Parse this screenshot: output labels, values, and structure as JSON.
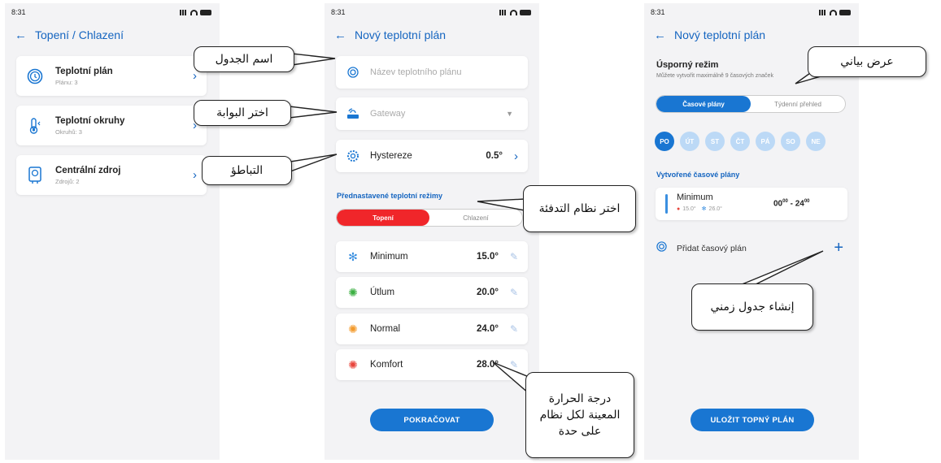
{
  "status_time": "8:31",
  "screen1": {
    "title": "Topení / Chlazení",
    "items": [
      {
        "title": "Teplotní plán",
        "sub": "Plánu: 3"
      },
      {
        "title": "Teplotní okruhy",
        "sub": "Okruhů: 3"
      },
      {
        "title": "Centrální zdroj",
        "sub": "Zdrojů: 2"
      }
    ]
  },
  "screen2": {
    "title": "Nový teplotní plán",
    "name_placeholder": "Název teplotního plánu",
    "gateway_placeholder": "Gateway",
    "hysteresis_label": "Hystereze",
    "hysteresis_value": "0.5°",
    "modes_title": "Přednastavené teplotní režimy",
    "seg_heating": "Topení",
    "seg_cooling": "Chlazení",
    "modes": [
      {
        "label": "Minimum",
        "value": "15.0°",
        "icon": "snowflake-icon"
      },
      {
        "label": "Útlum",
        "value": "20.0°",
        "icon": "sun-green-icon"
      },
      {
        "label": "Normal",
        "value": "24.0°",
        "icon": "sun-orange-icon"
      },
      {
        "label": "Komfort",
        "value": "28.0°",
        "icon": "sun-red-icon"
      }
    ],
    "continue_button": "POKRAČOVAT"
  },
  "screen3": {
    "title": "Nový teplotní plán",
    "mode_title": "Úsporný režim",
    "mode_sub": "Můžete vytvořit maximálně 9 časových značek",
    "seg_plans": "Časové plány",
    "seg_overview": "Týdenní přehled",
    "days": [
      "PO",
      "ÚT",
      "ST",
      "ČT",
      "PÁ",
      "SO",
      "NE"
    ],
    "created_title": "Vytvořené časové plány",
    "plan": {
      "name": "Minimum",
      "heat": "15.0°",
      "cool": "26.0°",
      "time_from": "00",
      "time_to": "24",
      "time_sup": "00"
    },
    "add_label": "Přidat časový plán",
    "add_symbol": "+",
    "save_button": "ULOŽIT TOPNÝ PLÁN"
  },
  "callouts": {
    "table_name": "اسم الجدول",
    "gateway": "اختر البوابة",
    "hysteresis": "التباطؤ",
    "heating_mode": "اختر نظام التدفئة",
    "view": "عرض بياني",
    "schedule": "إنشاء جدول زمني",
    "temperature": [
      "درجة الحرارة",
      "المعينة لكل نظام",
      "على حدة"
    ]
  },
  "colors": {
    "accent": "#1976d2",
    "heating": "#f0262a",
    "background": "#f3f3f5"
  }
}
